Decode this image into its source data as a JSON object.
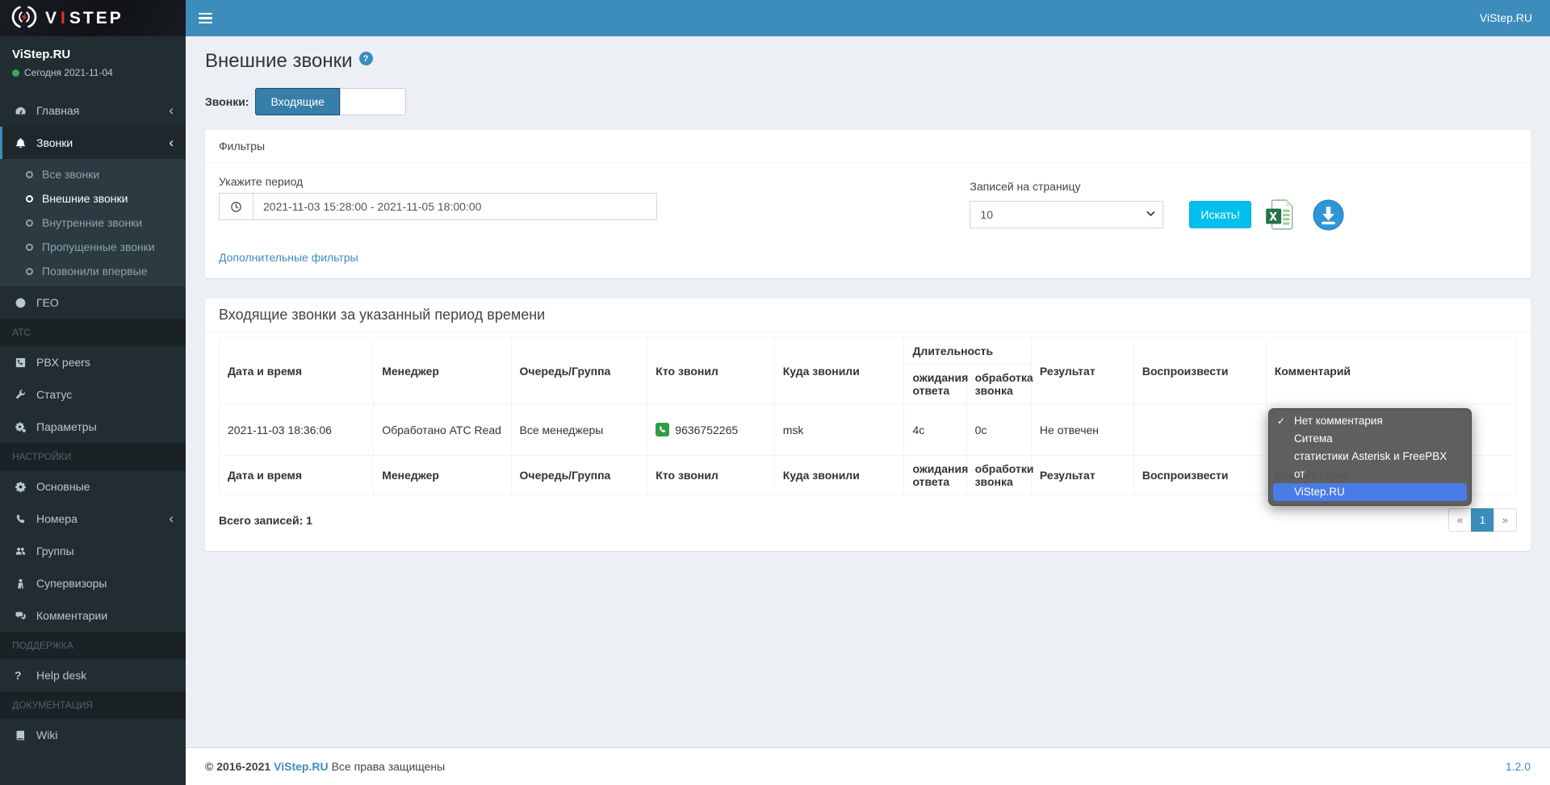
{
  "colors": {
    "accent": "#3c8dbc",
    "info_button": "#00c0ef",
    "success_green": "#2f9e44",
    "dropdown_highlight": "#4a7ce8",
    "sidebar_bg": "#222d32"
  },
  "logo": {
    "v": "V",
    "i": "I",
    "step": "STEP"
  },
  "topbar": {
    "account": "ViStep.RU"
  },
  "sidebar": {
    "user_name": "ViStep.RU",
    "user_status": "Сегодня 2021-11-04",
    "items": {
      "glavnaya": "Главная",
      "zvonki": "Звонки",
      "geo": "ГЕО",
      "pbx_peers": "PBX peers",
      "status": "Статус",
      "parametry": "Параметры",
      "osnovnye": "Основные",
      "nomera": "Номера",
      "gruppy": "Группы",
      "supervizory": "Супервизоры",
      "kommentarii": "Комментарии",
      "helpdesk": "Help desk",
      "wiki": "Wiki"
    },
    "submenu": {
      "vse": "Все звонки",
      "vneshnie": "Внешние звонки",
      "vnutrennie": "Внутренние звонки",
      "propushchennye": "Пропущенные звонки",
      "pozvonili": "Позвонили впервые"
    },
    "sections": {
      "atc": "АТС",
      "nastroyki": "НАСТРОЙКИ",
      "podderzhka": "ПОДДЕРЖКА",
      "dokumentaciya": "ДОКУМЕНТАЦИЯ"
    },
    "chevron": "‹"
  },
  "page": {
    "title": "Внешние звонки",
    "help": "?",
    "calls_label": "Звонки:",
    "toggle_incoming": "Входящие",
    "toggle_other": ""
  },
  "filters": {
    "box_title": "Фильтры",
    "period_label": "Укажите период",
    "period_value": "2021-11-03 15:28:00 - 2021-11-05 18:00:00",
    "per_page_label": "Записей на страницу",
    "per_page_value": "10",
    "search_button": "Искать!",
    "more_filters_link": "Дополнительные фильтры"
  },
  "table": {
    "box_title": "Входящие звонки за указанный период времени",
    "headers": {
      "datetime": "Дата и время",
      "manager": "Менеджер",
      "queue": "Очередь/Группа",
      "caller": "Кто звонил",
      "callee": "Куда звонили",
      "duration_group": "Длительность",
      "wait": "ожидания ответа",
      "processing": "обработка звонка",
      "result": "Результат",
      "play": "Воспроизвести",
      "comment": "Комментарий"
    },
    "footer_headers": {
      "wait": "ожидания ответа",
      "processing": "обработки звонка"
    },
    "row": {
      "datetime": "2021-11-03 18:36:06",
      "manager": "Обработано АТС Read",
      "queue": "Все менеджеры",
      "caller": "9636752265",
      "callee": "msk",
      "wait": "4с",
      "processing": "0с",
      "result": "Не отвечен",
      "play": "",
      "comment": ""
    },
    "total": "Всего записей: 1",
    "pagination": {
      "prev": "«",
      "page": "1",
      "next": "»"
    }
  },
  "dropdown": {
    "check": "✓",
    "items": [
      {
        "label": "Нет комментария",
        "checked": true
      },
      {
        "label": "Ситема",
        "checked": false
      },
      {
        "label": "статистики Asterisk и FreePBX",
        "checked": false
      },
      {
        "label": "от",
        "checked": false
      },
      {
        "label": "ViStep.RU",
        "checked": false,
        "highlighted": true
      }
    ]
  },
  "footer": {
    "copyright_prefix": "© 2016-2021",
    "brand_link": "ViStep.RU",
    "copyright_suffix": "Все права защищены",
    "version": "1.2.0"
  }
}
